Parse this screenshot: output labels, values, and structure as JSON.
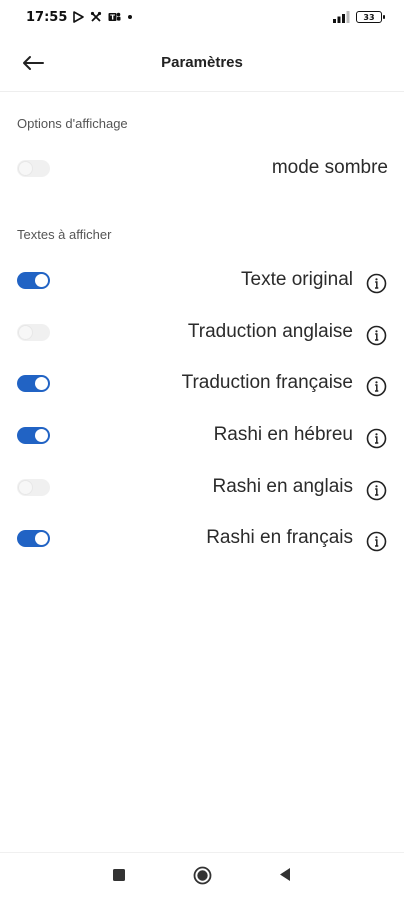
{
  "status_bar": {
    "time": "17:55",
    "battery": "33",
    "left_icons": [
      "play-store-icon",
      "tools-icon",
      "teams-icon",
      "dot-icon"
    ],
    "right_icons": [
      "signal-icon",
      "battery-icon"
    ]
  },
  "header": {
    "title": "Paramètres",
    "back_icon": "arrow-left-icon"
  },
  "sections": {
    "display": {
      "title": "Options d'affichage",
      "items": [
        {
          "label": "mode sombre",
          "enabled": false
        }
      ]
    },
    "texts": {
      "title": "Textes à afficher",
      "items": [
        {
          "label": "Texte original",
          "enabled": true
        },
        {
          "label": "Traduction anglaise",
          "enabled": false
        },
        {
          "label": "Traduction française",
          "enabled": true
        },
        {
          "label": "Rashi en hébreu",
          "enabled": true
        },
        {
          "label": "Rashi en anglais",
          "enabled": false
        },
        {
          "label": "Rashi en français",
          "enabled": true
        }
      ]
    }
  },
  "nav_bar": {
    "buttons": [
      "recent-apps-icon",
      "home-icon",
      "back-icon"
    ]
  },
  "colors": {
    "toggle_on": "#2163c4",
    "toggle_off": "#f0f0f0",
    "background": "#ffffff"
  }
}
